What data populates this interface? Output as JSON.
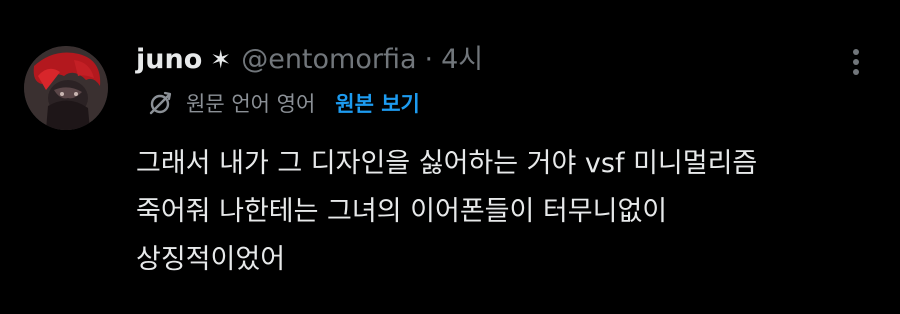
{
  "tweet": {
    "author": {
      "display_name": "juno",
      "badge_glyph": "✶",
      "handle": "@entomorfia"
    },
    "separator": "·",
    "timestamp": "4시",
    "translation": {
      "icon": "translate-icon",
      "label": "원문 언어 영어",
      "show_original": "원본 보기"
    },
    "text_lines": [
      "그래서 내가 그 디자인을 싫어하는 거야 vsf 미니멀리즘",
      "죽어줘 나한테는 그녀의 이어폰들이 터무니없이",
      "상징적이었어"
    ],
    "more_icon": "more-vertical-icon"
  },
  "colors": {
    "background": "#000000",
    "text_primary": "#e7e9ea",
    "text_secondary": "#71767b",
    "link_blue": "#1d9bf0"
  }
}
